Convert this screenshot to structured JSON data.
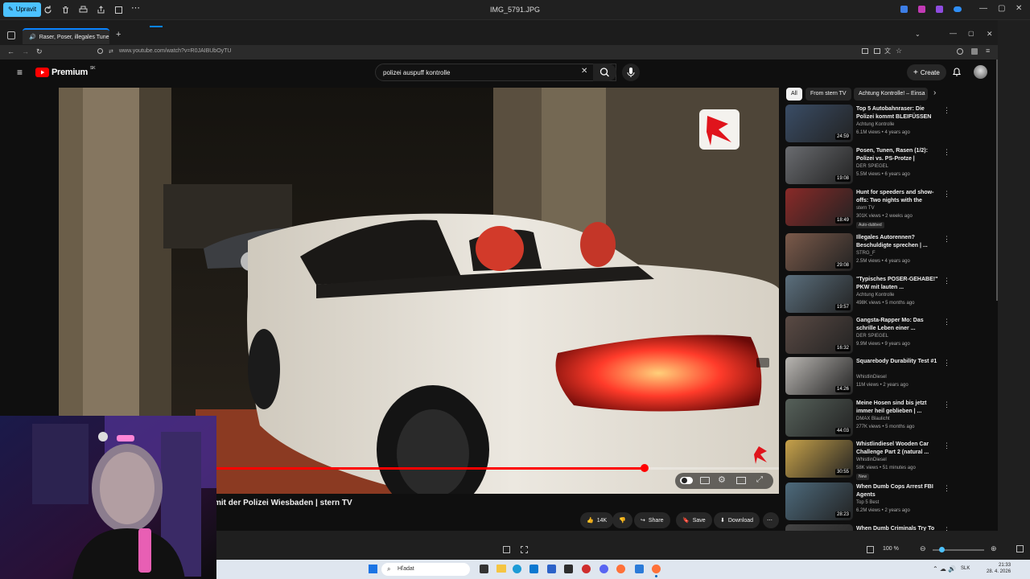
{
  "viewer": {
    "edit_label": "Upravit",
    "title": "IMG_5791.JPG",
    "zoom": "100 %"
  },
  "browser": {
    "tab_title": "Raser, Poser, illegales Tune",
    "url": "www.youtube.com/watch?v=R0JAIBUbOyTU"
  },
  "youtube": {
    "logo": "Premium",
    "logo_sup": "SK",
    "search_query": "polizei auspuff kontrolle",
    "create_label": "Create",
    "video_title": "mit der Polizei Wiesbaden | stern TV",
    "progress": 0.813,
    "actions": {
      "likes": "14K",
      "share": "Share",
      "save": "Save",
      "download": "Download"
    },
    "chips": [
      "All",
      "From stern TV",
      "Achtung Kontrolle! – Einsa"
    ],
    "recommendations": [
      {
        "title": "Top 5 Autobahnraser: Die Polizei kommt BLEIFÜSSEN au...",
        "channel": "Achtung Kontrolle",
        "meta": "6.1M views • 4 years ago",
        "duration": "24:59",
        "thumb": "#3a4d66"
      },
      {
        "title": "Posen, Tunen, Rasen (1/2): Polizei vs. PS-Protze | SPIEGE...",
        "channel": "DER SPIEGEL",
        "meta": "5.5M views • 6 years ago",
        "duration": "19:08",
        "thumb": "#6a6c70"
      },
      {
        "title": "Hunt for speeders and show-offs: Two nights with the polic...",
        "channel": "stern TV",
        "meta": "301K views • 2 weeks ago",
        "duration": "18:49",
        "thumb": "#8a2a28",
        "badge": "Auto-dubbed"
      },
      {
        "title": "Illegales Autorennen? Beschuldigte sprechen | ...",
        "channel": "STRG_F",
        "meta": "2.5M views • 4 years ago",
        "duration": "29:08",
        "thumb": "#7b5a4a"
      },
      {
        "title": "\"Typisches POSER-GEHABE!\" PKW mit lauten ...",
        "channel": "Achtung Kontrolle",
        "meta": "498K views • 5 months ago",
        "duration": "19:57",
        "thumb": "#5b6f7d"
      },
      {
        "title": "Gangsta-Rapper Mo: Das schrille Leben einer ...",
        "channel": "DER SPIEGEL",
        "meta": "9.9M views • 9 years ago",
        "duration": "16:32",
        "thumb": "#5a4a44"
      },
      {
        "title": "Squarebody Durability Test #1",
        "channel": "WhistlinDiesel",
        "meta": "11M views • 2 years ago",
        "duration": "14:26",
        "thumb": "#b9b6b2"
      },
      {
        "title": "Meine Hosen sind bis jetzt immer heil geblieben | ...",
        "channel": "DMAX Blaulicht",
        "meta": "277K views • 5 months ago",
        "duration": "44:03",
        "thumb": "#56615a"
      },
      {
        "title": "Whistlindiesel Wooden Car Challenge Part 2 (natural ...",
        "channel": "WhistlinDiesel",
        "meta": "58K views • 51 minutes ago",
        "duration": "30:55",
        "thumb": "#c7a24a",
        "badge": "New"
      },
      {
        "title": "When Dumb Cops Arrest FBI Agents",
        "channel": "Top 5 Best",
        "meta": "6.2M views • 2 years ago",
        "duration": "28:23",
        "thumb": "#4d6a7c"
      },
      {
        "title": "When Dumb Criminals Try To",
        "channel": "",
        "meta": "",
        "duration": "",
        "thumb": "#444"
      }
    ]
  },
  "taskbar": {
    "search_placeholder": "Hľadat",
    "lang": "SLK",
    "time": "21:33",
    "date": "28. 4. 2026"
  }
}
